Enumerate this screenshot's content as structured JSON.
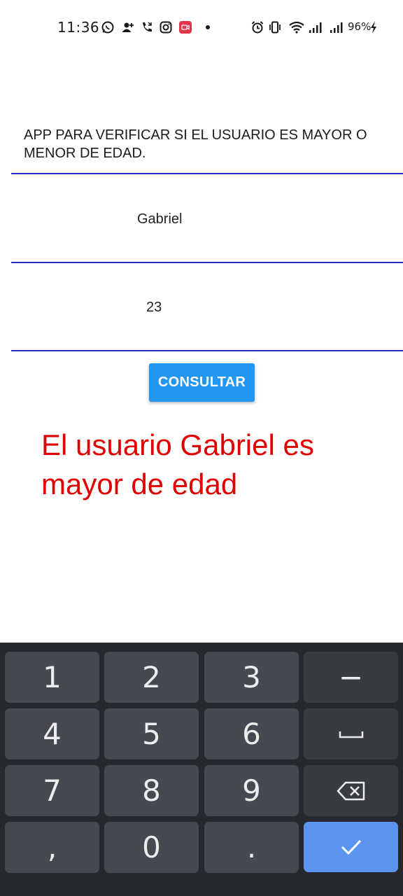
{
  "status_bar": {
    "time": "11:36",
    "battery": "96%",
    "left_icons": [
      "whatsapp-icon",
      "add-contact-icon",
      "call-icon",
      "instagram-icon",
      "screen-record-icon",
      "dot-icon"
    ],
    "right_icons": [
      "alarm-icon",
      "vibrate-icon",
      "wifi-icon",
      "signal-icon",
      "signal-icon",
      "charging-icon"
    ]
  },
  "app": {
    "heading": "APP PARA VERIFICAR SI EL USUARIO ES MAYOR O MENOR DE EDAD.",
    "name_value": "Gabriel",
    "age_value": "23",
    "button_label": "CONSULTAR",
    "result_text": "El usuario Gabriel  es mayor de edad",
    "accent_color": "#2196f3",
    "result_color": "#e00000",
    "underline_color": "#2b2bbd"
  },
  "keyboard": {
    "rows": [
      [
        "1",
        "2",
        "3",
        "−"
      ],
      [
        "4",
        "5",
        "6",
        "space"
      ],
      [
        "7",
        "8",
        "9",
        "backspace"
      ],
      [
        ",",
        "0",
        ".",
        "enter"
      ]
    ],
    "labels": {
      "k1": "1",
      "k2": "2",
      "k3": "3",
      "minus": "−",
      "k4": "4",
      "k5": "5",
      "k6": "6",
      "k7": "7",
      "k8": "8",
      "k9": "9",
      "comma": ",",
      "k0": "0",
      "period": "."
    },
    "key_color": "#454a50",
    "function_key_color": "#383c41",
    "enter_color": "#5c95ef",
    "background": "#25282c"
  }
}
